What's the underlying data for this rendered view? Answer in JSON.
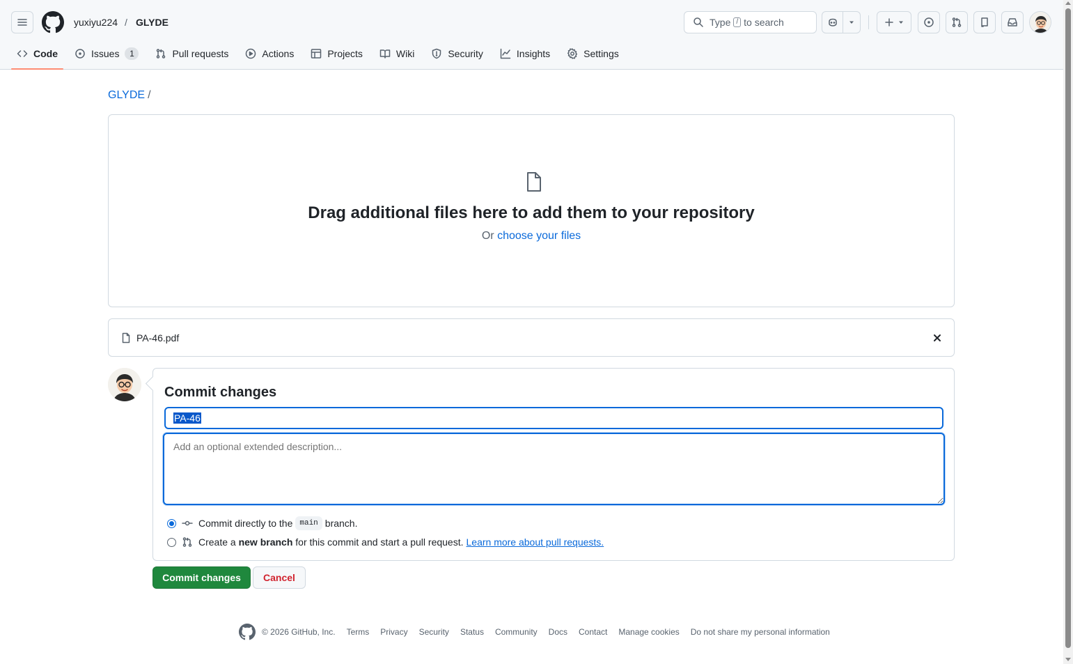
{
  "header": {
    "owner": "yuxiyu224",
    "separator": "/",
    "repo": "GLYDE",
    "search": {
      "prefix": "Type",
      "key": "/",
      "suffix": "to search"
    }
  },
  "tabs": [
    {
      "label": "Code",
      "icon": "code-icon",
      "active": true
    },
    {
      "label": "Issues",
      "icon": "issue-opened-icon",
      "counter": "1"
    },
    {
      "label": "Pull requests",
      "icon": "git-pull-request-icon"
    },
    {
      "label": "Actions",
      "icon": "play-icon"
    },
    {
      "label": "Projects",
      "icon": "table-icon"
    },
    {
      "label": "Wiki",
      "icon": "book-icon"
    },
    {
      "label": "Security",
      "icon": "shield-icon"
    },
    {
      "label": "Insights",
      "icon": "graph-icon"
    },
    {
      "label": "Settings",
      "icon": "gear-icon"
    }
  ],
  "breadcrumb": {
    "repo": "GLYDE",
    "separator": "/"
  },
  "dropzone": {
    "title": "Drag additional files here to add them to your repository",
    "sub_prefix": "Or",
    "sub_link": "choose your files"
  },
  "file": {
    "name": "PA-46.pdf"
  },
  "commit": {
    "title": "Commit changes",
    "message_value": "PA-46",
    "description_placeholder": "Add an optional extended description...",
    "option_direct": {
      "prefix": "Commit directly to the",
      "branch": "main",
      "suffix": "branch.",
      "selected": true
    },
    "option_new": {
      "prefix": "Create a",
      "bold": "new branch",
      "suffix": "for this commit and start a pull request.",
      "link": "Learn more about pull requests.",
      "selected": false
    },
    "submit_label": "Commit changes",
    "cancel_label": "Cancel"
  },
  "footer": {
    "copyright": "© 2026 GitHub, Inc.",
    "links": [
      "Terms",
      "Privacy",
      "Security",
      "Status",
      "Community",
      "Docs",
      "Contact",
      "Manage cookies",
      "Do not share my personal information"
    ]
  },
  "colors": {
    "accent": "#0969da",
    "primary_button": "#1f883d",
    "danger": "#d1242f",
    "tab_underline": "#fd8c73"
  }
}
